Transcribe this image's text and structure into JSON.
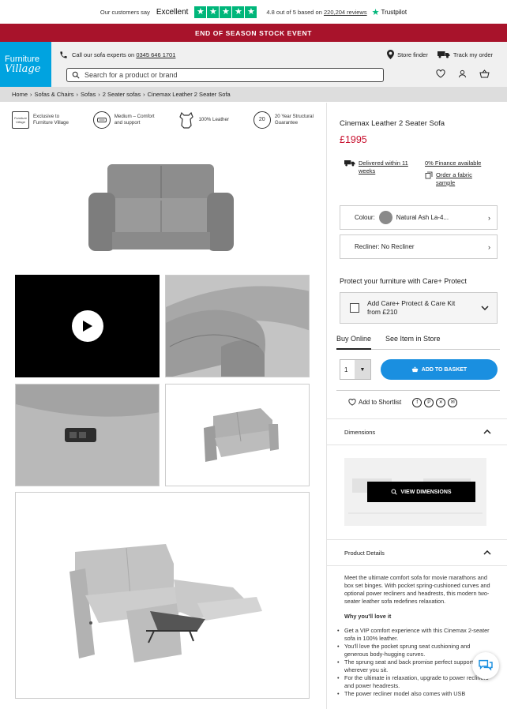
{
  "trustpilot": {
    "prefix": "Our customers say",
    "rating_word": "Excellent",
    "stars": 5,
    "rating_text": "4.8 out of 5 based on",
    "reviews_link": "220,204 reviews",
    "brand": "Trustpilot"
  },
  "promo": {
    "text": "END OF SEASON STOCK EVENT"
  },
  "header": {
    "logo_line1": "Furniture",
    "logo_line2": "Village",
    "call_text": "Call our",
    "call_bold": "sofa experts",
    "call_on": "on",
    "phone": "0345 646 1701",
    "store_finder": "Store finder",
    "track_order": "Track my order",
    "search_placeholder": "Search for a product or brand"
  },
  "breadcrumb": [
    "Home",
    "Sofas & Chairs",
    "Sofas",
    "2 Seater sofas",
    "Cinemax Leather 2 Seater Sofa"
  ],
  "features": [
    {
      "icon": "exclusive-badge-icon",
      "line1": "Exclusive to",
      "line2": "Furniture Village"
    },
    {
      "icon": "cushion-icon",
      "line1": "Medium – Comfort",
      "line2": "and support"
    },
    {
      "icon": "leather-hide-icon",
      "line1": "100% Leather",
      "line2": ""
    },
    {
      "icon": "guarantee-20-icon",
      "line1": "20 Year Structural",
      "line2": "Guarantee"
    }
  ],
  "badge_20": "20",
  "exclusive_badge_text": "Furniture Village",
  "product": {
    "title": "Cinemax Leather 2 Seater Sofa",
    "price": "£1995",
    "delivery_line": "Delivered within 11 weeks",
    "finance": "0% Finance available",
    "fabric_sample": "Order a fabric sample",
    "colour_label": "Colour:",
    "colour_value": "Natural Ash La-4...",
    "recliner": "Recliner: No Recliner",
    "protect_heading": "Protect your furniture with Care+ Protect",
    "careplus_line1": "Add Care+ Protect & Care Kit",
    "careplus_line2": "from £210",
    "tab_online": "Buy Online",
    "tab_store": "See Item in Store",
    "qty": "1",
    "add_to_basket": "ADD TO BASKET",
    "add_to_shortlist": "Add to Shortlist"
  },
  "accordions": {
    "dimensions": "Dimensions",
    "view_dimensions": "VIEW DIMENSIONS",
    "product_details": "Product Details"
  },
  "details": {
    "intro": "Meet the ultimate comfort sofa for movie marathons and box set binges. With pocket spring-cushioned curves and optional power recliners and headrests, this modern two-seater leather sofa redefines relaxation.",
    "why": "Why you'll love it",
    "bullets": [
      "Get a VIP comfort experience with this Cinemax 2-seater sofa in 100% leather.",
      "You'll love the pocket sprung seat cushioning and generous body-hugging curves.",
      "The sprung seat and back promise perfect support, wherever you sit.",
      "For the ultimate in relaxation, upgrade to power recliners and power headrests.",
      "The power recliner model also comes with USB"
    ]
  },
  "colors": {
    "brand_blue": "#00a3e0",
    "promo_red": "#a8132b",
    "price_red": "#c8102e",
    "trustpilot_green": "#00b67a",
    "button_blue": "#1a8fe0",
    "leather_grey": "#8a8a8a"
  }
}
